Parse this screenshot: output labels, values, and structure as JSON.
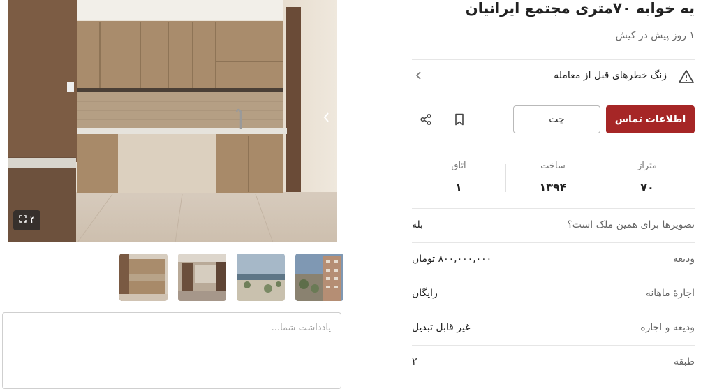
{
  "listing": {
    "title": "یه خوابه ۷۰متری مجتمع ایرانیان",
    "subtitle": "۱ روز پیش در کیش"
  },
  "warning": {
    "text": "زنگ خطرهای قبل از معامله",
    "icon": "warning-triangle-icon"
  },
  "actions": {
    "contact_label": "اطلاعات تماس",
    "chat_label": "چت",
    "contact_color": "#a62626"
  },
  "stats": [
    {
      "label": "متراژ",
      "value": "۷۰"
    },
    {
      "label": "ساخت",
      "value": "۱۳۹۴"
    },
    {
      "label": "اتاق",
      "value": "۱"
    }
  ],
  "details": [
    {
      "key": "تصویرها برای همین ملک است؟",
      "value": "بله"
    },
    {
      "key": "ودیعه",
      "value": "۸۰۰,۰۰۰,۰۰۰ تومان"
    },
    {
      "key": "اجارهٔ ماهانه",
      "value": "رایگان"
    },
    {
      "key": "ودیعه و اجاره",
      "value": "غیر قابل تبدیل"
    },
    {
      "key": "طبقه",
      "value": "۲"
    }
  ],
  "gallery": {
    "count": "۴"
  },
  "note": {
    "placeholder": "یادداشت شما..."
  }
}
